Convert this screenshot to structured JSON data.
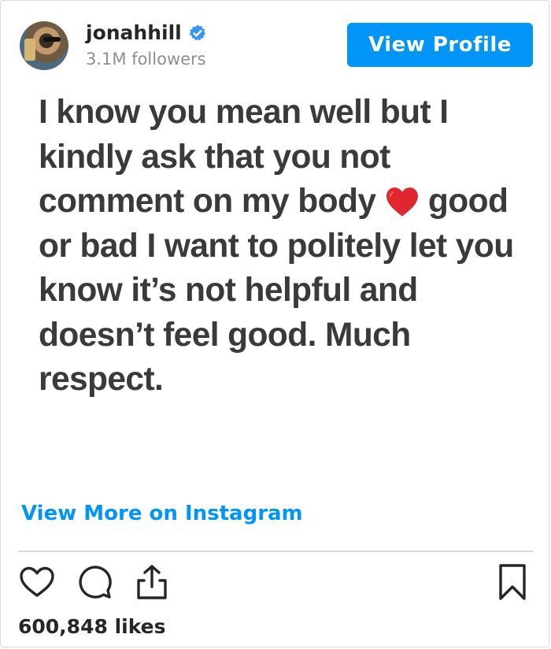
{
  "header": {
    "username": "jonahhill",
    "followers": "3.1M followers",
    "view_profile_label": "View Profile"
  },
  "post": {
    "text_before_heart": "I know you mean well but I kindly ask that you not comment on my body",
    "text_after_heart": "good or bad I want to politely let you know it’s not helpful and doesn’t feel good. Much respect."
  },
  "footer": {
    "view_more_label": "View More on Instagram",
    "likes": "600,848 likes"
  },
  "colors": {
    "accent": "#0095f6",
    "heart": "#e0262e",
    "post_text": "#3a3a3a"
  }
}
